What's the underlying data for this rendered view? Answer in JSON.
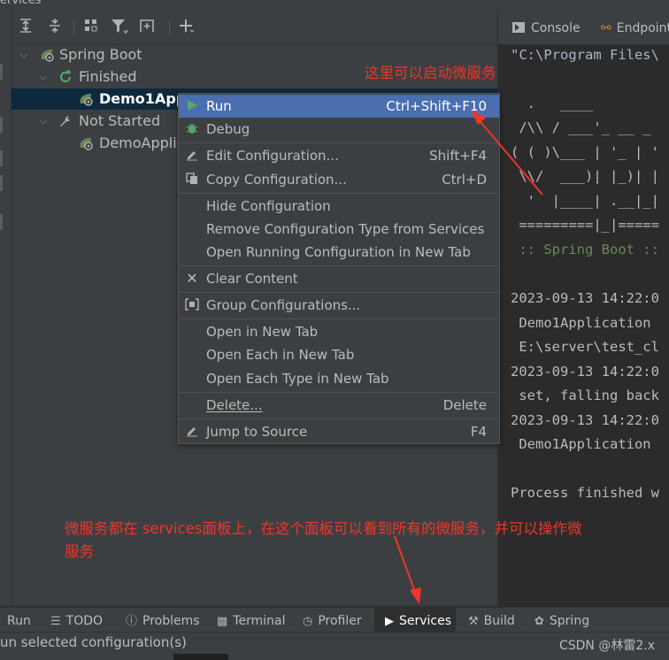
{
  "window": {
    "title_fragment": "ervices"
  },
  "toolbar": {
    "icons": [
      "expand-all-icon",
      "collapse-all-icon",
      "group-by-icon",
      "filter-icon",
      "new-tab-icon",
      "add-icon"
    ]
  },
  "tree": {
    "root": "Spring Boot",
    "group_finished": "Finished",
    "item_demo1": "Demo1Appl",
    "group_not_started": "Not Started",
    "item_demo": "DemoApplic"
  },
  "context_menu": {
    "run": {
      "label": "Run",
      "shortcut": "Ctrl+Shift+F10"
    },
    "debug": {
      "label": "Debug"
    },
    "edit_config": {
      "label": "Edit Configuration...",
      "shortcut": "Shift+F4"
    },
    "copy_config": {
      "label": "Copy Configuration...",
      "shortcut": "Ctrl+D"
    },
    "hide_config": {
      "label": "Hide Configuration"
    },
    "remove_type": {
      "label": "Remove Configuration Type from Services"
    },
    "open_running": {
      "label": "Open Running Configuration in New Tab"
    },
    "clear_content": {
      "label": "Clear Content"
    },
    "group_configs": {
      "label": "Group Configurations..."
    },
    "open_new_tab": {
      "label": "Open in New Tab"
    },
    "open_each": {
      "label": "Open Each in New Tab"
    },
    "open_each_type": {
      "label": "Open Each Type in New Tab"
    },
    "delete": {
      "label": "Delete...",
      "shortcut": "Delete"
    },
    "jump_source": {
      "label": "Jump to Source",
      "shortcut": "F4"
    }
  },
  "console": {
    "tab_console": "Console",
    "tab_endpoints": "Endpoint",
    "lines": [
      "\"C:\\Program Files\\",
      "  .   ____",
      " /\\\\ / ___'_ __ _",
      "( ( )\\___ | '_ | '",
      " \\\\/  ___)| |_)| |",
      "  '  |____| .__|_|",
      " =========|_|=====",
      " :: Spring Boot ::",
      "2023-09-13 14:22:0",
      " Demo1Application",
      " E:\\server\\test_cl",
      "2023-09-13 14:22:0",
      " set, falling back",
      "2023-09-13 14:22:0",
      " Demo1Application",
      "Process finished w"
    ]
  },
  "annotations": {
    "run_note": "这里可以启动微服务",
    "services_note_line1": "微服务都在 services面板上，在这个面板可以看到所有的微服务，并可以操作微",
    "services_note_line2": "服务"
  },
  "bottom_tabs": {
    "run": "Run",
    "todo": "TODO",
    "problems": "Problems",
    "terminal": "Terminal",
    "profiler": "Profiler",
    "services": "Services",
    "build": "Build",
    "spring": "Spring"
  },
  "status": {
    "text": "un selected configuration(s)",
    "watermark": "CSDN @林雷2.x"
  },
  "colors": {
    "menu_highlight": "#4b6eaf",
    "annotation_red": "#f0352a",
    "run_green": "#59a869",
    "spring_green": "#6a8759"
  }
}
